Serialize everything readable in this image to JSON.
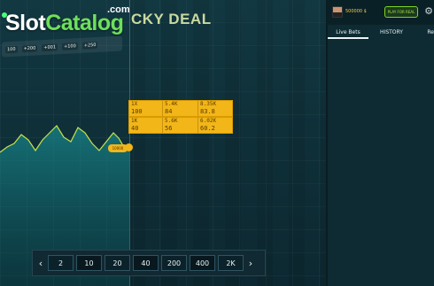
{
  "watermark": {
    "prefix": "Slot",
    "main": "Catalog",
    "suffix": ".com"
  },
  "game": {
    "brand": "CKY DEAL"
  },
  "chips": [
    "100",
    "+200",
    "+001",
    "+100",
    "+250"
  ],
  "bets": [
    {
      "c1a": "1X",
      "c1b": "100",
      "c2a": "5.4K",
      "c2b": "84",
      "c3a": "8.35K",
      "c3b": "83.8"
    },
    {
      "c1a": "1K",
      "c1b": "40",
      "c2a": "5.6K",
      "c2b": "56",
      "c3a": "6.02K",
      "c3b": "60.2"
    }
  ],
  "marker_label": "10000",
  "stake_bar": {
    "prev": "‹",
    "next": "›",
    "options": [
      "2",
      "10",
      "20",
      "40",
      "200",
      "400",
      "2K"
    ]
  },
  "panel": {
    "balance": "500000 $",
    "play_for_real": "PLAY FOR REAL",
    "settings_icon": "gear-icon",
    "tabs": [
      "Live Bets",
      "HISTORY",
      "Re"
    ]
  },
  "colors": {
    "accent_gold": "#f2b619",
    "chart_line": "#c9e34a",
    "play_real_border": "#7ed321",
    "background": "#0d2630"
  }
}
